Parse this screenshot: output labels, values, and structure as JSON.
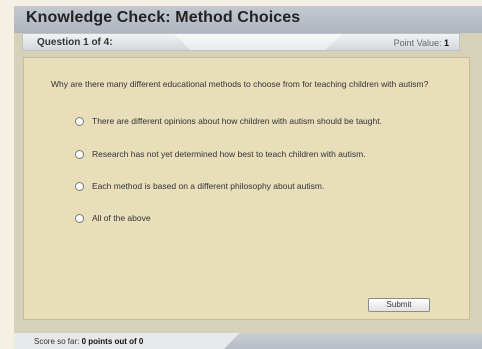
{
  "header": {
    "title": "Knowledge Check: Method Choices"
  },
  "question_bar": {
    "question_number": "Question 1 of 4:",
    "point_value_label": "Point Value:",
    "point_value": "1"
  },
  "question": {
    "text": "Why are there many different educational methods to choose from for teaching children with autism?",
    "options": [
      "There are different opinions about how children with autism should be taught.",
      "Research has not yet determined how best to teach children with autism.",
      "Each method is based on a different philosophy about autism.",
      "All of the above"
    ]
  },
  "actions": {
    "submit_label": "Submit"
  },
  "footer": {
    "score_label": "Score so far:",
    "score_value": "0 points out of 0"
  },
  "colors": {
    "content_bg": "#e8deba",
    "title_bar": "#b8bec6",
    "frame": "#d6d2ba"
  }
}
